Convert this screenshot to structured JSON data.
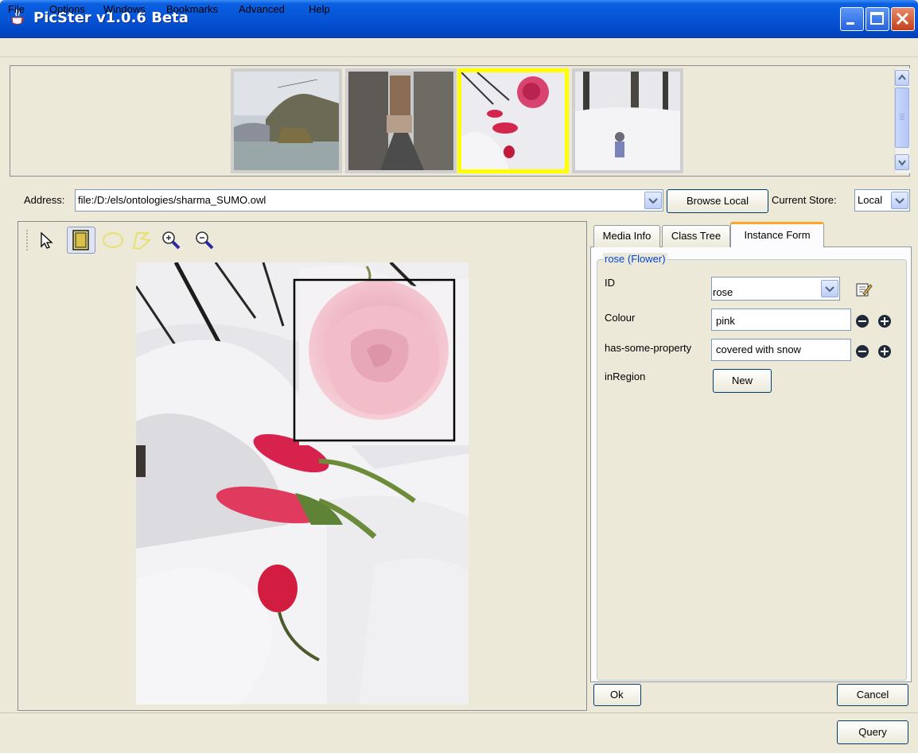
{
  "window": {
    "title": "PicSter v1.0.6 Beta"
  },
  "menu": {
    "items": [
      "File",
      "Options",
      "Windows",
      "Bookmarks",
      "Advanced",
      "Help"
    ]
  },
  "address": {
    "label": "Address:",
    "value": "file:/D:/els/ontologies/sharma_SUMO.owl",
    "browse_label": "Browse Local",
    "store_label": "Current Store:",
    "store_value": "Local"
  },
  "tabs": [
    "Media Info",
    "Class Tree",
    "Instance Form"
  ],
  "form": {
    "legend": "rose (Flower)",
    "id_label": "ID",
    "id_value": "rose",
    "colour_label": "Colour",
    "colour_value": "pink",
    "property_label": "has-some-property",
    "property_value": "covered with snow",
    "region_label": "inRegion",
    "new_label": "New",
    "ok_label": "Ok",
    "cancel_label": "Cancel"
  },
  "footer": {
    "query_label": "Query"
  },
  "colors": {
    "titlebar": "#0654d6",
    "selected_thumb_border": "#ffff00",
    "active_tab_accent": "#f9a72a",
    "legend_text": "#0046d5"
  },
  "icons": [
    "java-cup-icon",
    "minimize-icon",
    "maximize-icon",
    "close-icon",
    "select-arrow-icon",
    "rectangle-tool-icon",
    "ellipse-tool-icon",
    "polygon-tool-icon",
    "zoom-in-icon",
    "zoom-out-icon",
    "edit-icon",
    "minus-icon",
    "plus-icon"
  ]
}
